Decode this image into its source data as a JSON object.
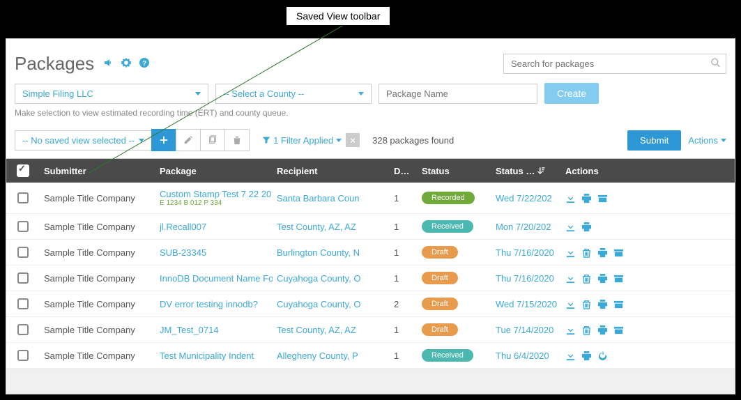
{
  "callout": {
    "label": "Saved View toolbar"
  },
  "page": {
    "title": "Packages"
  },
  "search": {
    "placeholder": "Search for packages"
  },
  "filters": {
    "org": "Simple Filing LLC",
    "county": "-- Select a County --",
    "package_name_placeholder": "Package Name",
    "create_label": "Create",
    "hint": "Make selection to view estimated recording time (ERT) and county queue."
  },
  "toolbar": {
    "saved_view": "-- No saved view selected --",
    "filter_text": "1 Filter Applied",
    "count_text": "328 packages found",
    "submit_label": "Submit",
    "actions_label": "Actions"
  },
  "columns": {
    "submitter": "Submitter",
    "package": "Package",
    "recipient": "Recipient",
    "docs": "D…",
    "status": "Status",
    "statusdate": "Status …",
    "actions": "Actions"
  },
  "rows": [
    {
      "submitter": "Sample Title Company",
      "package": "Custom Stamp Test 7 22 20",
      "sub": "E 1234 B 012 P 334",
      "recipient": "Santa Barbara Coun",
      "docs": "1",
      "status": "Recorded",
      "status_class": "recorded",
      "date": "Wed 7/22/202",
      "icons": [
        "download",
        "print",
        "archive"
      ]
    },
    {
      "submitter": "Sample Title Company",
      "package": "jl.Recall007",
      "recipient": "Test County, AZ, AZ",
      "docs": "1",
      "status": "Received",
      "status_class": "received",
      "date": "Mon 7/20/202",
      "icons": [
        "download",
        "print"
      ]
    },
    {
      "submitter": "Sample Title Company",
      "package": "SUB-23345",
      "recipient": "Burlington County, N",
      "docs": "1",
      "status": "Draft",
      "status_class": "draft",
      "date": "Thu 7/16/2020",
      "icons": [
        "download",
        "trash",
        "print",
        "archive"
      ]
    },
    {
      "submitter": "Sample Title Company",
      "package": "InnoDB Document Name Fo",
      "recipient": "Cuyahoga County, O",
      "docs": "1",
      "status": "Draft",
      "status_class": "draft",
      "date": "Thu 7/16/2020",
      "icons": [
        "download",
        "trash",
        "print",
        "archive"
      ]
    },
    {
      "submitter": "Sample Title Company",
      "package": "DV error testing innodb?",
      "recipient": "Cuyahoga County, O",
      "docs": "2",
      "status": "Draft",
      "status_class": "draft",
      "date": "Wed 7/15/2020",
      "icons": [
        "download",
        "trash",
        "print",
        "archive"
      ]
    },
    {
      "submitter": "Sample Title Company",
      "package": "JM_Test_0714",
      "recipient": "Test County, AZ, AZ",
      "docs": "1",
      "status": "Draft",
      "status_class": "draft",
      "date": "Tue 7/14/2020",
      "icons": [
        "download",
        "trash",
        "print",
        "archive"
      ]
    },
    {
      "submitter": "Sample Title Company",
      "package": "Test Municipality Indent",
      "recipient": "Allegheny County, P",
      "docs": "1",
      "status": "Received",
      "status_class": "received",
      "date": "Thu 6/4/2020",
      "icons": [
        "download",
        "print",
        "undo"
      ]
    }
  ]
}
